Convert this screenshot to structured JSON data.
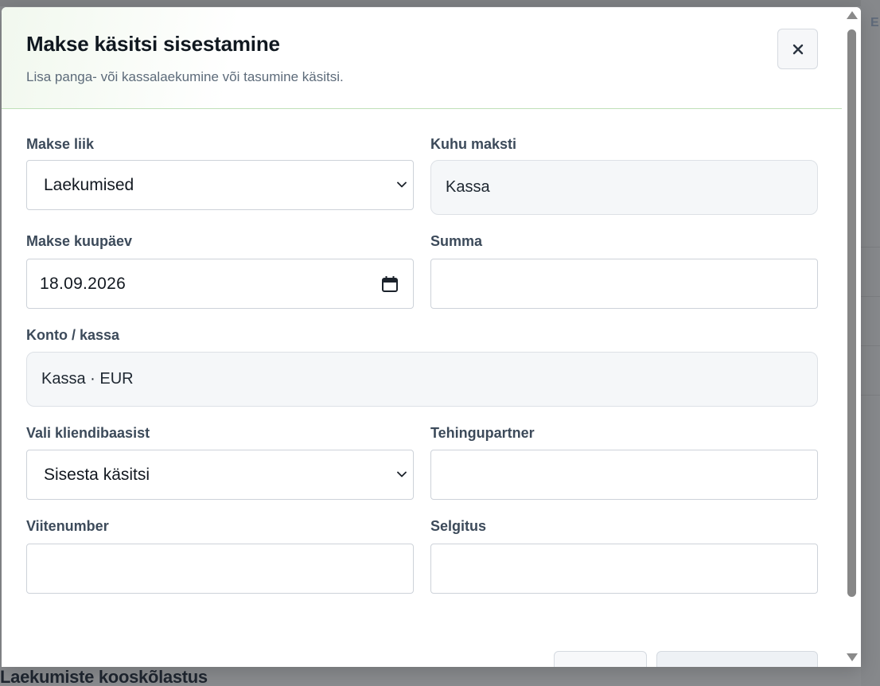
{
  "background": {
    "glyph": "E",
    "bottom_title": "Laekumiste kooskõlastus"
  },
  "modal": {
    "title": "Makse käsitsi sisestamine",
    "subtitle": "Lisa panga- või kassalaekumine või tasumine käsitsi.",
    "close_icon": "close-icon"
  },
  "form": {
    "payment_type": {
      "label": "Makse liik",
      "value": "Laekumised",
      "icon": "chevron-down-icon"
    },
    "paid_to": {
      "label": "Kuhu maksti",
      "value": "Kassa"
    },
    "payment_date": {
      "label": "Makse kuupäev",
      "value": "18.09.2026",
      "icon": "calendar-icon"
    },
    "amount": {
      "label": "Summa",
      "value": ""
    },
    "account": {
      "label": "Konto / kassa",
      "value": "Kassa · EUR"
    },
    "client_select": {
      "label": "Vali kliendibaasist",
      "value": "Sisesta käsitsi",
      "icon": "chevron-down-icon"
    },
    "partner": {
      "label": "Tehingupartner",
      "value": ""
    },
    "reference": {
      "label": "Viitenumber",
      "value": ""
    },
    "description": {
      "label": "Selgitus",
      "value": ""
    }
  },
  "colors": {
    "header_accent": "#bfe0b8",
    "title": "#101820",
    "label": "#3c4a5a",
    "border": "#cdd2d9",
    "readonly_bg": "#f5f7f9"
  }
}
